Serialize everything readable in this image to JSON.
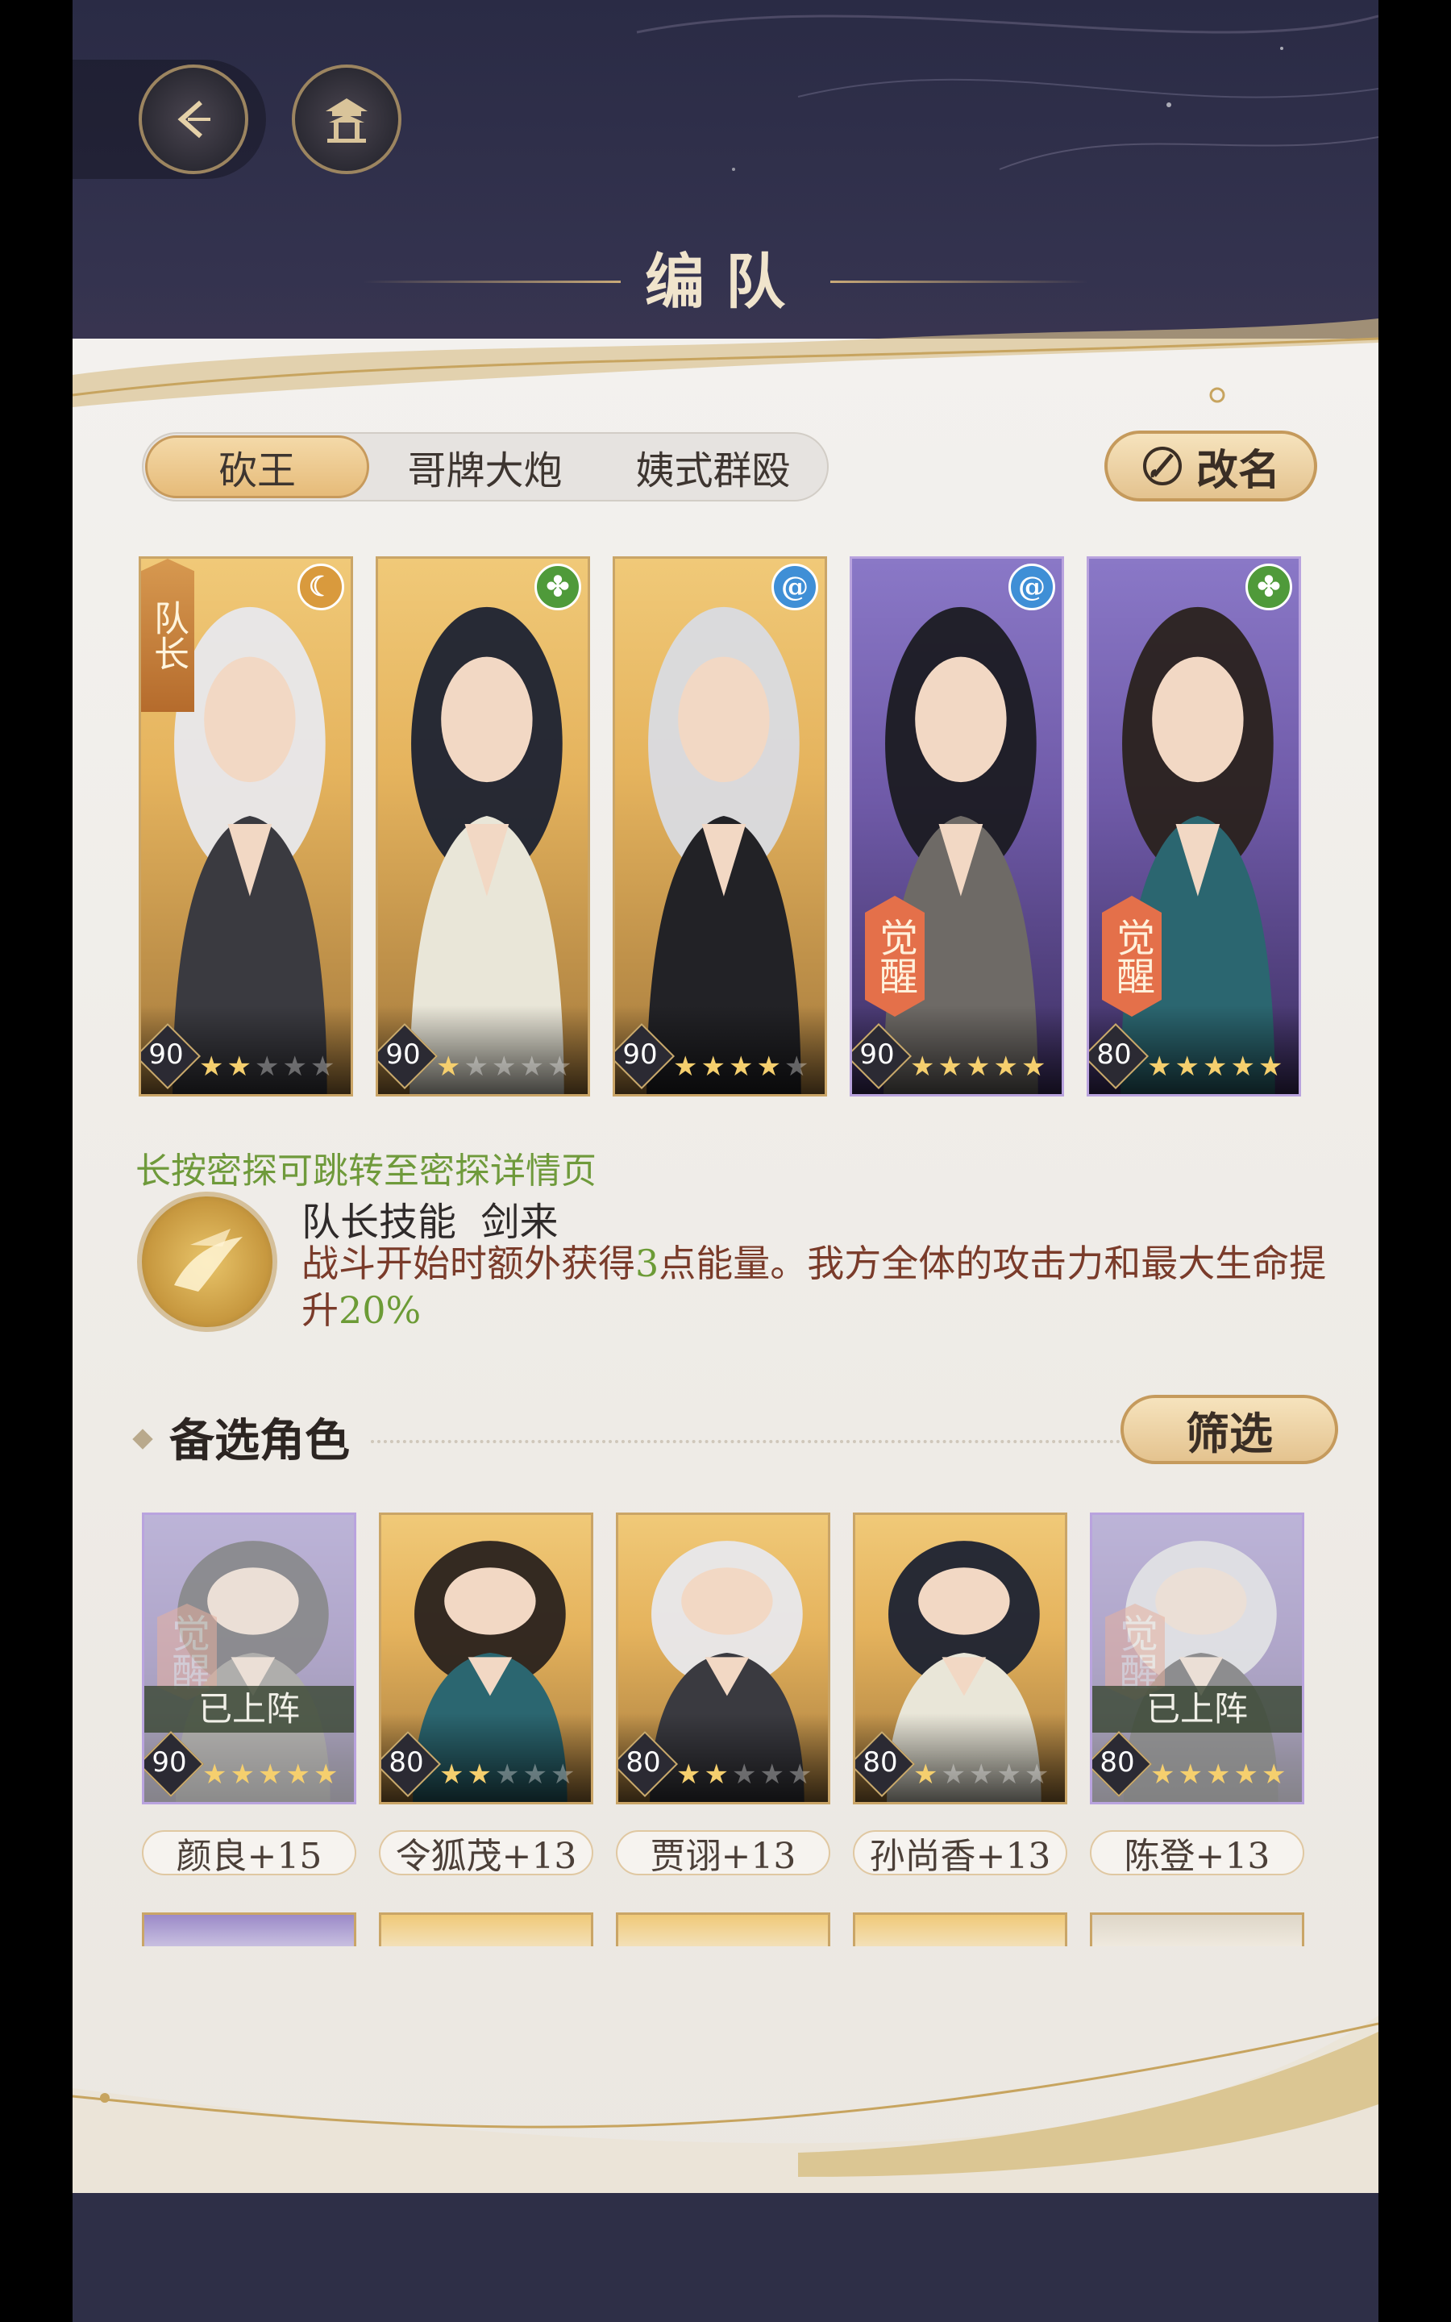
{
  "header": {
    "title": "编队",
    "back_icon": "back-arrow-icon",
    "pavilion_icon": "pavilion-icon"
  },
  "tabs": [
    {
      "label": "砍王",
      "active": true
    },
    {
      "label": "哥牌大炮",
      "active": false
    },
    {
      "label": "姨式群殴",
      "active": false
    }
  ],
  "rename_button": {
    "label": "改名",
    "icon": "brush-icon"
  },
  "team": [
    {
      "level": "90",
      "stars": 5,
      "lit_stars": 2,
      "element": "moon",
      "element_color": "#d99a3d",
      "tag": "队长",
      "frame": "gold"
    },
    {
      "level": "90",
      "stars": 5,
      "lit_stars": 1,
      "element": "leaf",
      "element_color": "#4f9a3a",
      "tag": "",
      "frame": "gold"
    },
    {
      "level": "90",
      "stars": 5,
      "lit_stars": 4,
      "element": "swirl",
      "element_color": "#3f8fd6",
      "tag": "",
      "frame": "gold"
    },
    {
      "level": "90",
      "stars": 5,
      "lit_stars": 5,
      "element": "swirl",
      "element_color": "#3f8fd6",
      "tag": "觉醒",
      "frame": "purple"
    },
    {
      "level": "80",
      "stars": 5,
      "lit_stars": 5,
      "element": "leaf",
      "element_color": "#4f9a3a",
      "tag": "觉醒",
      "frame": "purple"
    }
  ],
  "hint": "长按密探可跳转至密探详情页",
  "leader_skill": {
    "name": "队长技能  剑来",
    "desc_a": "战斗开始时额外获得",
    "desc_num": "3",
    "desc_b": "点能量。我方全体的攻击力和最大生命提升",
    "desc_pct": "20%"
  },
  "reserve": {
    "title": "备选角色",
    "filter_label": "筛选",
    "on_team_label": "已上阵",
    "items": [
      {
        "name": "颜良+15",
        "level": "90",
        "lit_stars": 5,
        "frame": "purple",
        "on_team": true,
        "awakened": true
      },
      {
        "name": "令狐茂+13",
        "level": "80",
        "lit_stars": 2,
        "frame": "gold",
        "on_team": false,
        "awakened": false
      },
      {
        "name": "贾诩+13",
        "level": "80",
        "lit_stars": 2,
        "frame": "gold",
        "on_team": false,
        "awakened": false
      },
      {
        "name": "孙尚香+13",
        "level": "80",
        "lit_stars": 1,
        "frame": "gold",
        "on_team": false,
        "awakened": false
      },
      {
        "name": "陈登+13",
        "level": "80",
        "lit_stars": 5,
        "frame": "purple",
        "on_team": true,
        "awakened": true
      }
    ]
  },
  "colors": {
    "accent_gold": "#e6bb79",
    "hint_green": "#6f9a3b",
    "desc_brown": "#7a3b2a",
    "awaken_orange": "#e4704a"
  }
}
